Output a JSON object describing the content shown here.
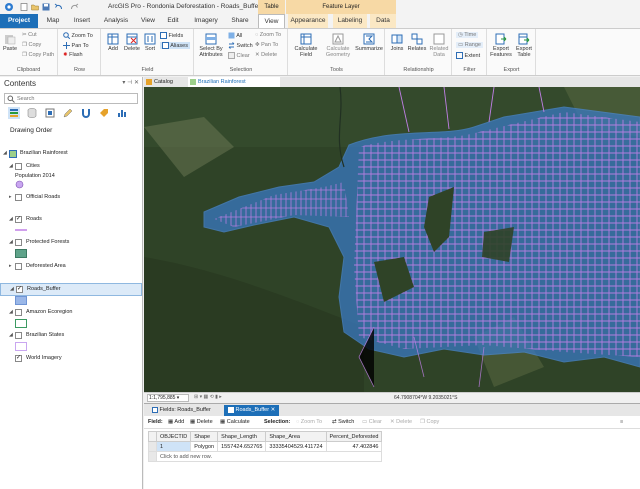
{
  "title_bar": {
    "title": "ArcGIS Pro - Rondonia Deforestation - Roads_Buffer",
    "context_table": "Table",
    "context_feature": "Feature Layer"
  },
  "tabs": [
    "Project",
    "Map",
    "Insert",
    "Analysis",
    "View",
    "Edit",
    "Imagery",
    "Share",
    "View",
    "Appearance",
    "Labeling",
    "Data"
  ],
  "ribbon": {
    "clipboard": {
      "label": "Clipboard",
      "paste": "Paste",
      "cut": "Cut",
      "copy": "Copy",
      "copy_path": "Copy Path"
    },
    "row": {
      "label": "Row",
      "zoom_to": "Zoom To",
      "pan_to": "Pan To",
      "flash": "Flash"
    },
    "field": {
      "label": "Field",
      "add": "Add",
      "delete": "Delete",
      "sort": "Sort",
      "fields": "Fields",
      "aliases": "Aliases"
    },
    "selection": {
      "label": "Selection",
      "select_by_attributes": "Select By Attributes",
      "all": "All",
      "switch": "Switch",
      "clear": "Clear",
      "zoom_to": "Zoom To",
      "pan_to": "Pan To",
      "delete": "Delete"
    },
    "tools": {
      "label": "Tools",
      "calculate_field": "Calculate Field",
      "calculate_geometry": "Calculate Geometry",
      "summarize": "Summarize"
    },
    "relationship": {
      "label": "Relationship",
      "joins": "Joins",
      "relates": "Relates",
      "related_data": "Related Data"
    },
    "filter": {
      "label": "Filter",
      "time": "Time",
      "range": "Range",
      "extent": "Extent"
    },
    "export": {
      "label": "Export",
      "export_features": "Export Features",
      "export_table": "Export Table"
    }
  },
  "contents": {
    "title": "Contents",
    "search_placeholder": "Search",
    "drawing_order": "Drawing Order",
    "map_name": "Brazilian Rainforest",
    "layers": [
      {
        "name": "Cities",
        "checked": false,
        "legend": "Population 2014"
      },
      {
        "name": "Official Roads",
        "checked": false
      },
      {
        "name": "Roads",
        "checked": true
      },
      {
        "name": "Protected Forests",
        "checked": false
      },
      {
        "name": "Deforested Area",
        "checked": false
      },
      {
        "name": "Roads_Buffer",
        "checked": true
      },
      {
        "name": "Amazon Ecoregion",
        "checked": false
      },
      {
        "name": "Brazilian States",
        "checked": false
      },
      {
        "name": "World Imagery",
        "checked": true
      }
    ]
  },
  "map": {
    "tabs": [
      "Catalog",
      "Brazilian Rainforest"
    ],
    "scale": "1:1,795,885",
    "coordinates": "64.7908704°W 9.2035021°S"
  },
  "table": {
    "tabs": [
      "Fields: Roads_Buffer",
      "Roads_Buffer"
    ],
    "toolbar": {
      "field_label": "Field:",
      "add": "Add",
      "delete": "Delete",
      "calculate": "Calculate",
      "selection_label": "Selection:",
      "zoom_to": "Zoom To",
      "switch": "Switch",
      "clear": "Clear",
      "delete_sel": "Delete",
      "copy": "Copy"
    },
    "columns": [
      "OBJECTID",
      "Shape",
      "Shape_Length",
      "Shape_Area",
      "Percent_Deforested"
    ],
    "rows": [
      [
        "1",
        "Polygon",
        "1557424.652765",
        "33335404529.411724",
        "47.402846"
      ]
    ],
    "add_row_text": "Click to add new row."
  },
  "colors": {
    "accent": "#1d6fb8",
    "buffer_fill": "#3a7bc8",
    "roads": "#c07fe6"
  }
}
